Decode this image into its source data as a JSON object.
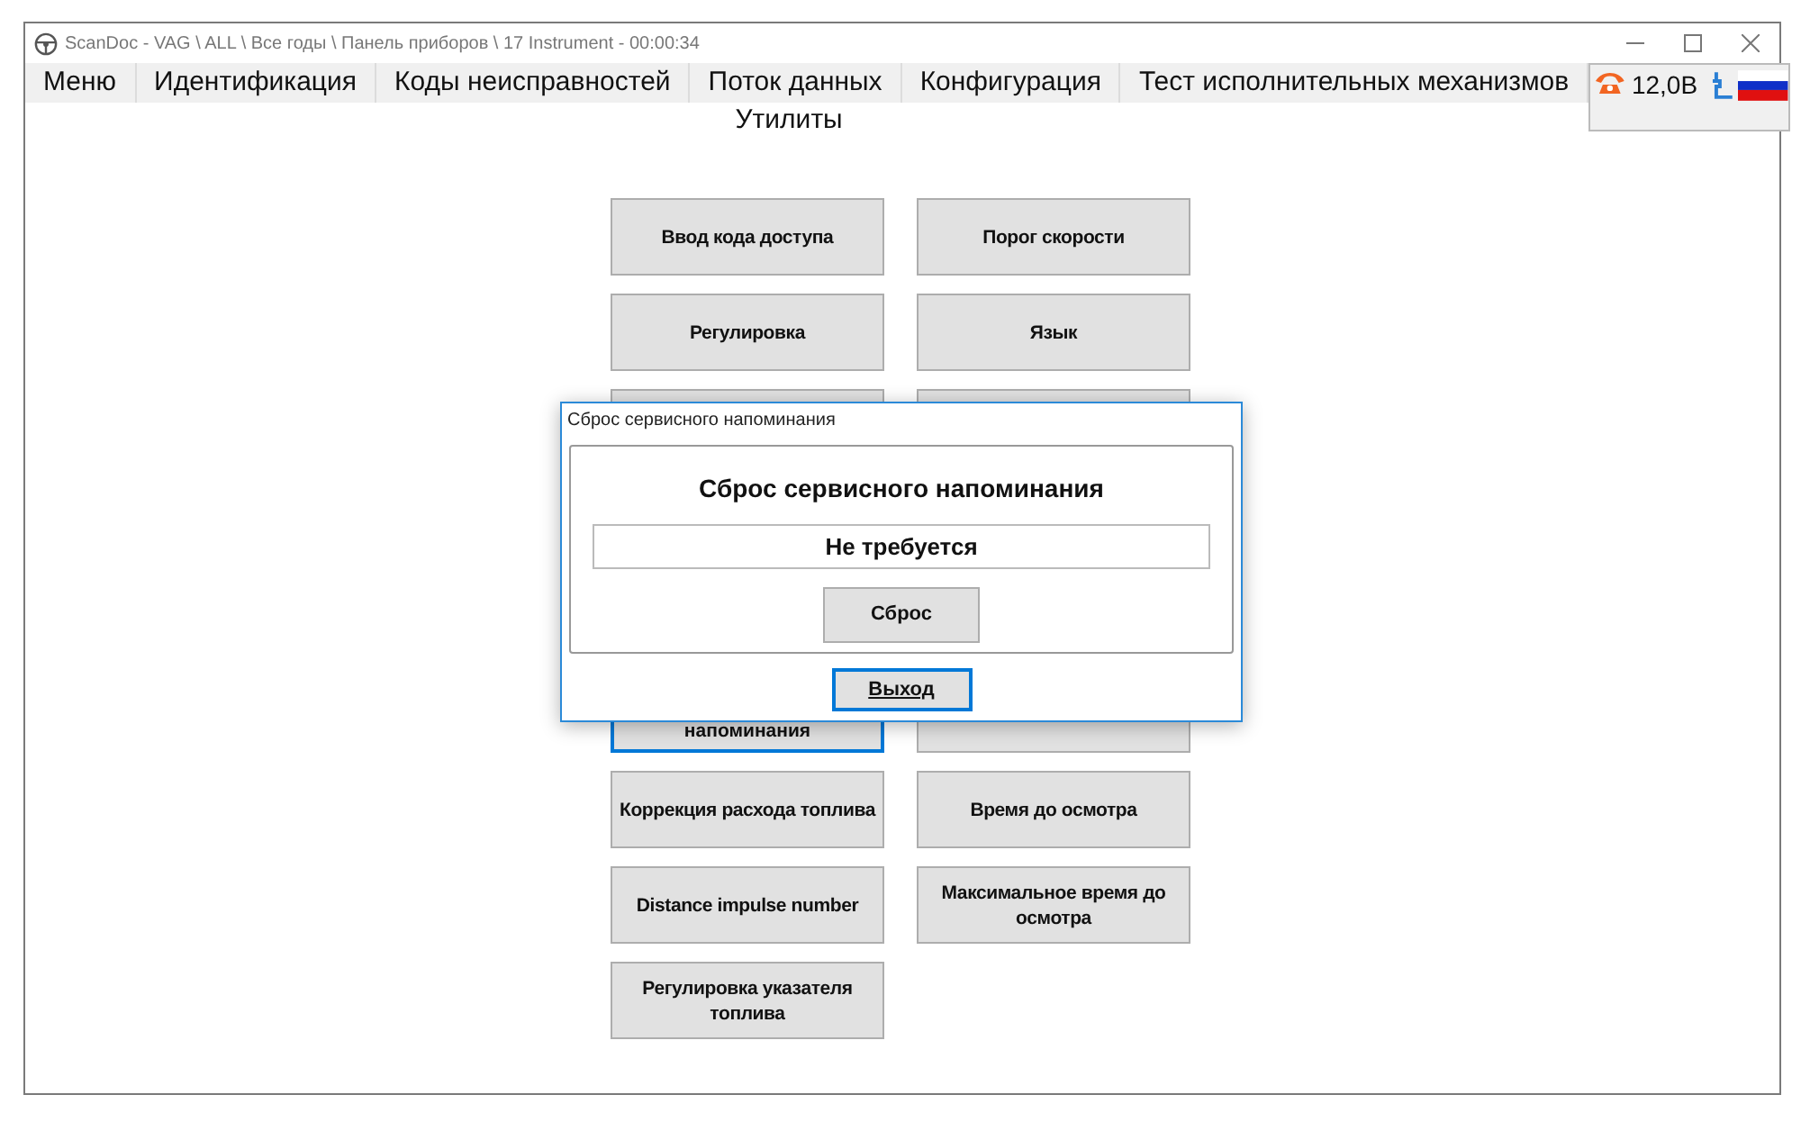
{
  "window": {
    "title": "ScanDoc - VAG \\ ALL \\ Все годы \\ Панель приборов \\ 17 Instrument - 00:00:34"
  },
  "menu": [
    {
      "label": "Меню"
    },
    {
      "label": "Идентификация"
    },
    {
      "label": "Коды неисправностей"
    },
    {
      "label": "Поток данных"
    },
    {
      "label": "Конфигурация"
    },
    {
      "label": "Тест исполнительных механизмов"
    }
  ],
  "menu_row2": [
    {
      "label": "Утилиты"
    }
  ],
  "status": {
    "voltage": "12,0В"
  },
  "utility_buttons": [
    {
      "kind": "button",
      "label": "Ввод кода доступа",
      "focused": false
    },
    {
      "kind": "button",
      "label": "Регулировка",
      "focused": false
    },
    {
      "kind": "covered"
    },
    {
      "kind": "spacer"
    },
    {
      "kind": "spacer"
    },
    {
      "kind": "partial",
      "label": "напоминания",
      "focused": true
    },
    {
      "kind": "button",
      "label": "Коррекция расхода топлива",
      "focused": false
    },
    {
      "kind": "button",
      "label": "Distance impulse number",
      "focused": false
    },
    {
      "kind": "button",
      "label": "Регулировка указателя топлива",
      "focused": false
    },
    {
      "kind": "button",
      "label": "Порог скорости",
      "focused": false
    },
    {
      "kind": "button",
      "label": "Язык",
      "focused": false
    },
    {
      "kind": "covered"
    },
    {
      "kind": "spacer"
    },
    {
      "kind": "spacer"
    },
    {
      "kind": "covered"
    },
    {
      "kind": "button",
      "label": "Время до осмотра",
      "focused": false
    },
    {
      "kind": "button",
      "label": "Максимальное время до осмотра",
      "focused": false
    }
  ],
  "dialog": {
    "title": "Сброс сервисного напоминания",
    "heading": "Сброс сервисного напоминания",
    "value": "Не требуется",
    "reset_button": "Сброс",
    "exit_button": "Выход"
  }
}
